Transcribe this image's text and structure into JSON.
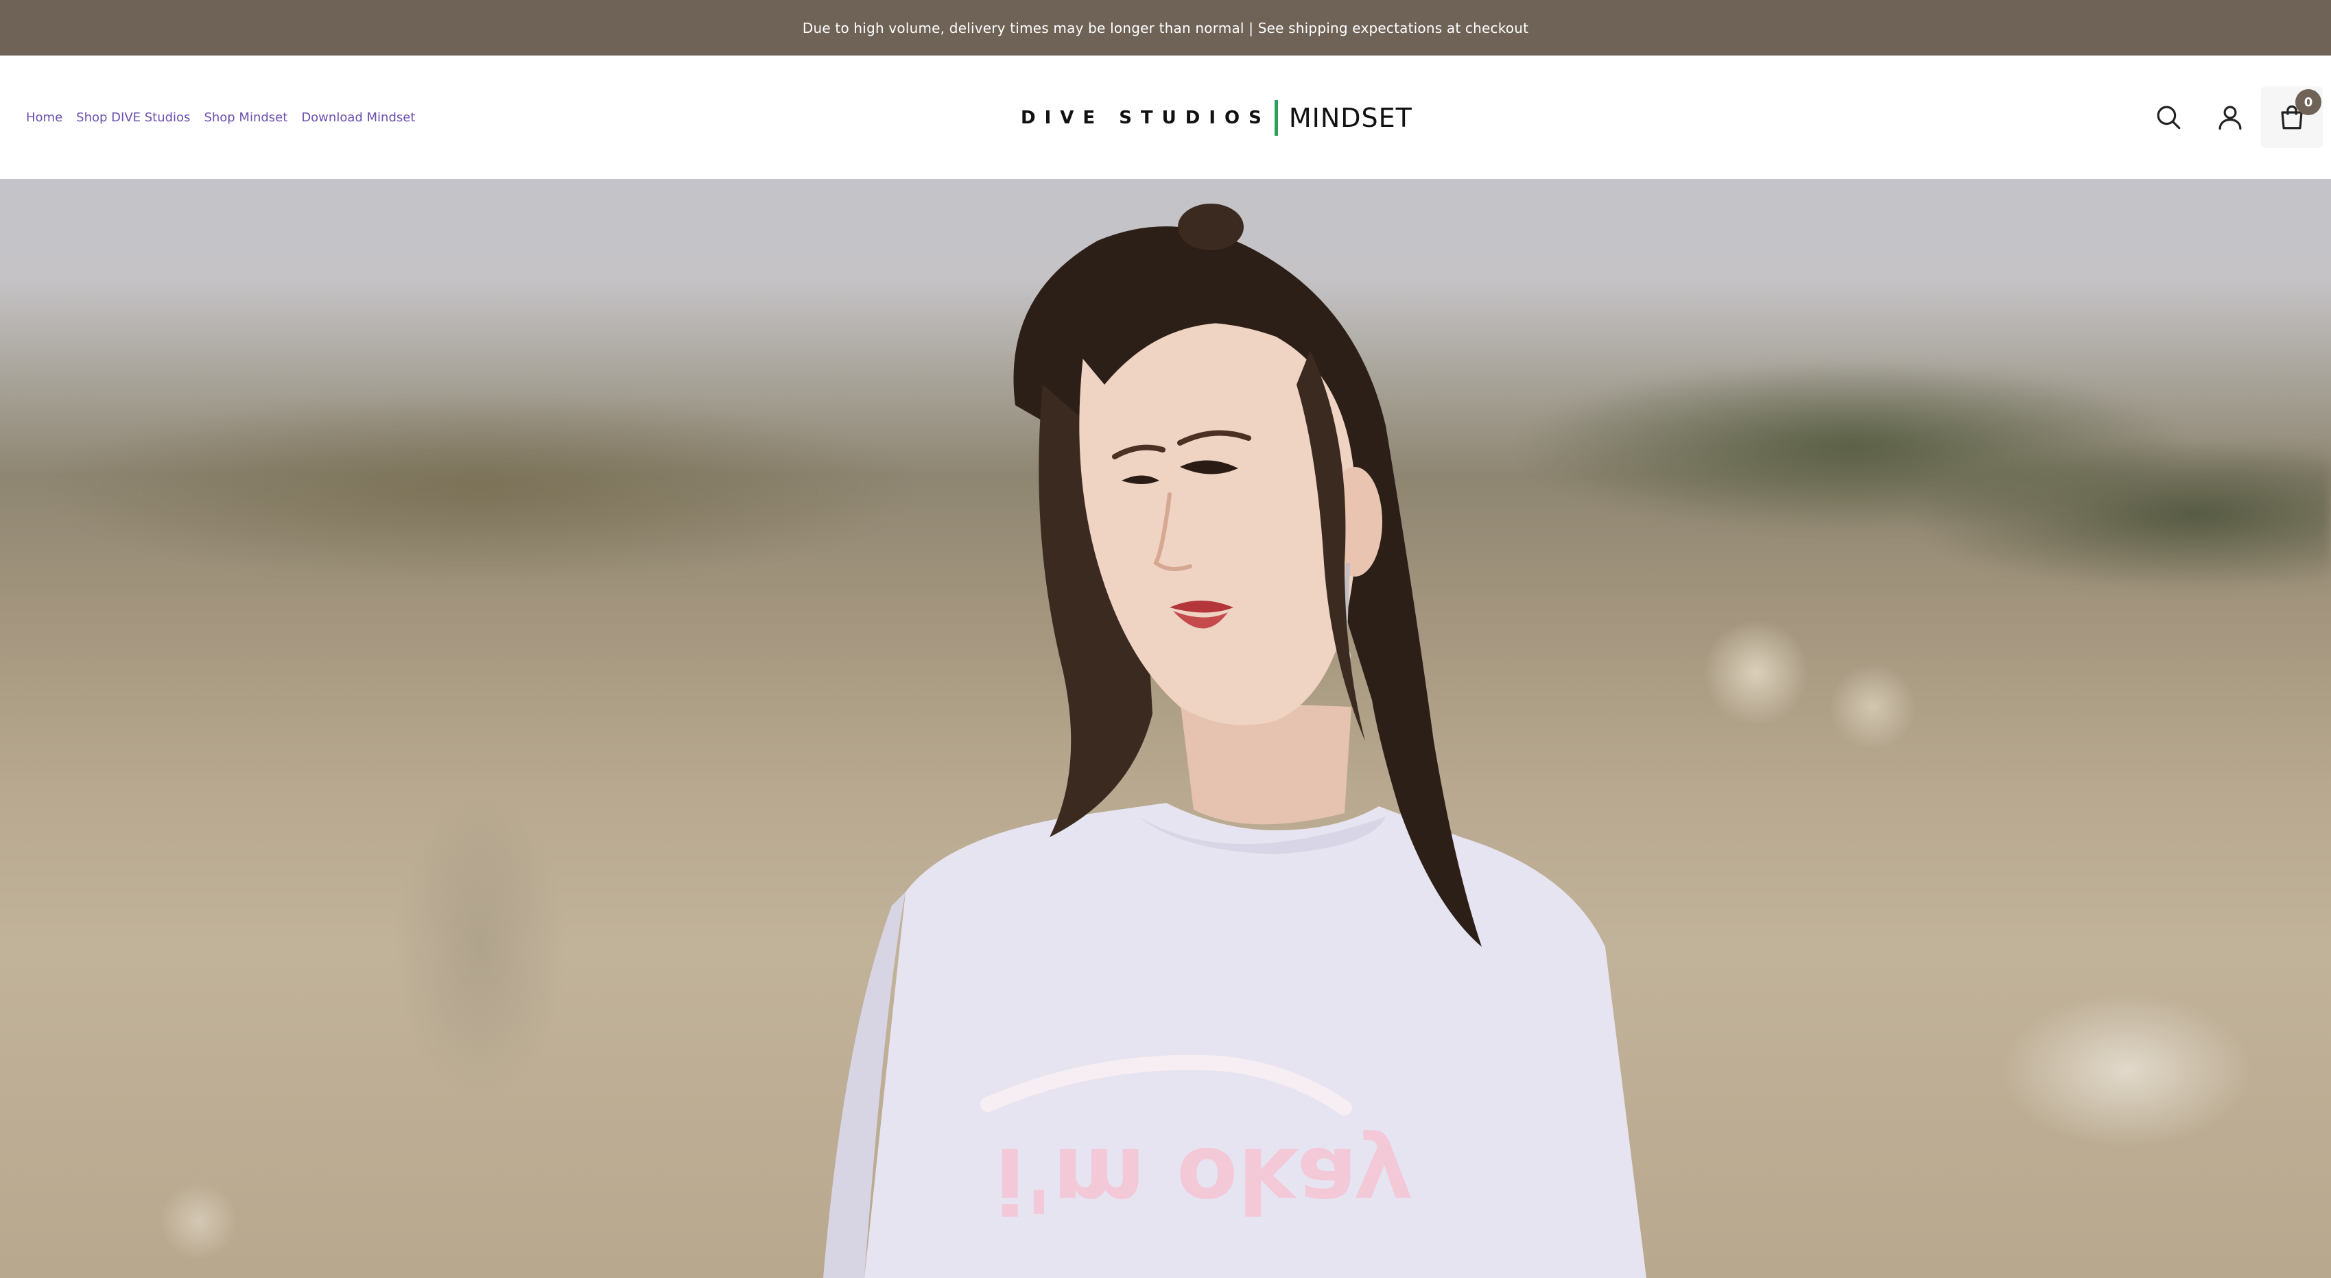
{
  "announcement": {
    "text": "Due to high volume, delivery times may be longer than normal | See shipping expectations at checkout"
  },
  "nav": {
    "items": [
      {
        "label": "Home"
      },
      {
        "label": "Shop DIVE Studios"
      },
      {
        "label": "Shop Mindset"
      },
      {
        "label": "Download Mindset"
      }
    ]
  },
  "logo": {
    "left_text": "DIVE STUDIOS",
    "right_text": "MINDSET"
  },
  "header_icons": {
    "search": "search-icon",
    "account": "user-icon",
    "cart": "shopping-bag-icon",
    "cart_count": "0"
  },
  "hero": {
    "image": "model-in-lavender-tshirt",
    "shirt_print": "i'm okay"
  },
  "colors": {
    "announcement_bg": "#6f6257",
    "nav_link": "#6b4fb0",
    "logo_divider": "#2e9e5b",
    "cart_badge_bg": "#6f6257"
  }
}
